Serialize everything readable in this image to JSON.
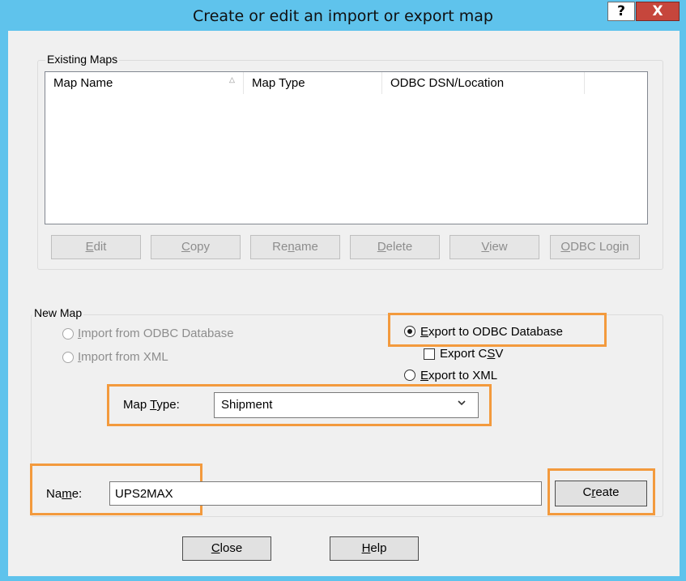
{
  "window": {
    "title": "Create or edit an import or export map",
    "help_glyph": "?",
    "close_glyph": "X"
  },
  "existing_maps": {
    "group_label": "Existing Maps",
    "columns": [
      "Map Name",
      "Map Type",
      "ODBC DSN/Location"
    ],
    "rows": [],
    "buttons": {
      "edit": {
        "pre": "",
        "u": "E",
        "post": "dit"
      },
      "copy": {
        "pre": "",
        "u": "C",
        "post": "opy"
      },
      "rename": {
        "pre": "Re",
        "u": "n",
        "post": "ame"
      },
      "delete": {
        "pre": "",
        "u": "D",
        "post": "elete"
      },
      "view": {
        "pre": "",
        "u": "V",
        "post": "iew"
      },
      "odbc_login": {
        "pre": "",
        "u": "O",
        "post": "DBC Login"
      }
    }
  },
  "new_map": {
    "group_label": "New Map",
    "import_odbc": {
      "pre": "",
      "u": "I",
      "post": "mport from ODBC Database",
      "selected": false,
      "enabled": false
    },
    "import_xml": {
      "pre": "",
      "u": "I",
      "post": "mport from XML",
      "selected": false,
      "enabled": false
    },
    "export_odbc": {
      "pre": "",
      "u": "E",
      "post": "xport to ODBC Database",
      "selected": true,
      "enabled": true
    },
    "export_csv": {
      "pre": "Export C",
      "u": "S",
      "post": "V",
      "checked": false
    },
    "export_xml": {
      "pre": "",
      "u": "E",
      "post": "xport to XML",
      "selected": false,
      "enabled": true
    },
    "map_type_label": {
      "pre": "Map ",
      "u": "T",
      "post": "ype:"
    },
    "map_type_value": "Shipment",
    "name_label": {
      "pre": "Na",
      "u": "m",
      "post": "e:"
    },
    "name_value": "UPS2MAX",
    "create_button": {
      "pre": "C",
      "u": "r",
      "post": "eate"
    }
  },
  "footer": {
    "close_button": {
      "pre": "",
      "u": "C",
      "post": "lose"
    },
    "help_button": {
      "pre": "",
      "u": "H",
      "post": "elp"
    }
  },
  "colors": {
    "titlebar": "#5fc3ec",
    "highlight": "#f39a3d",
    "close_button": "#c6463c"
  }
}
